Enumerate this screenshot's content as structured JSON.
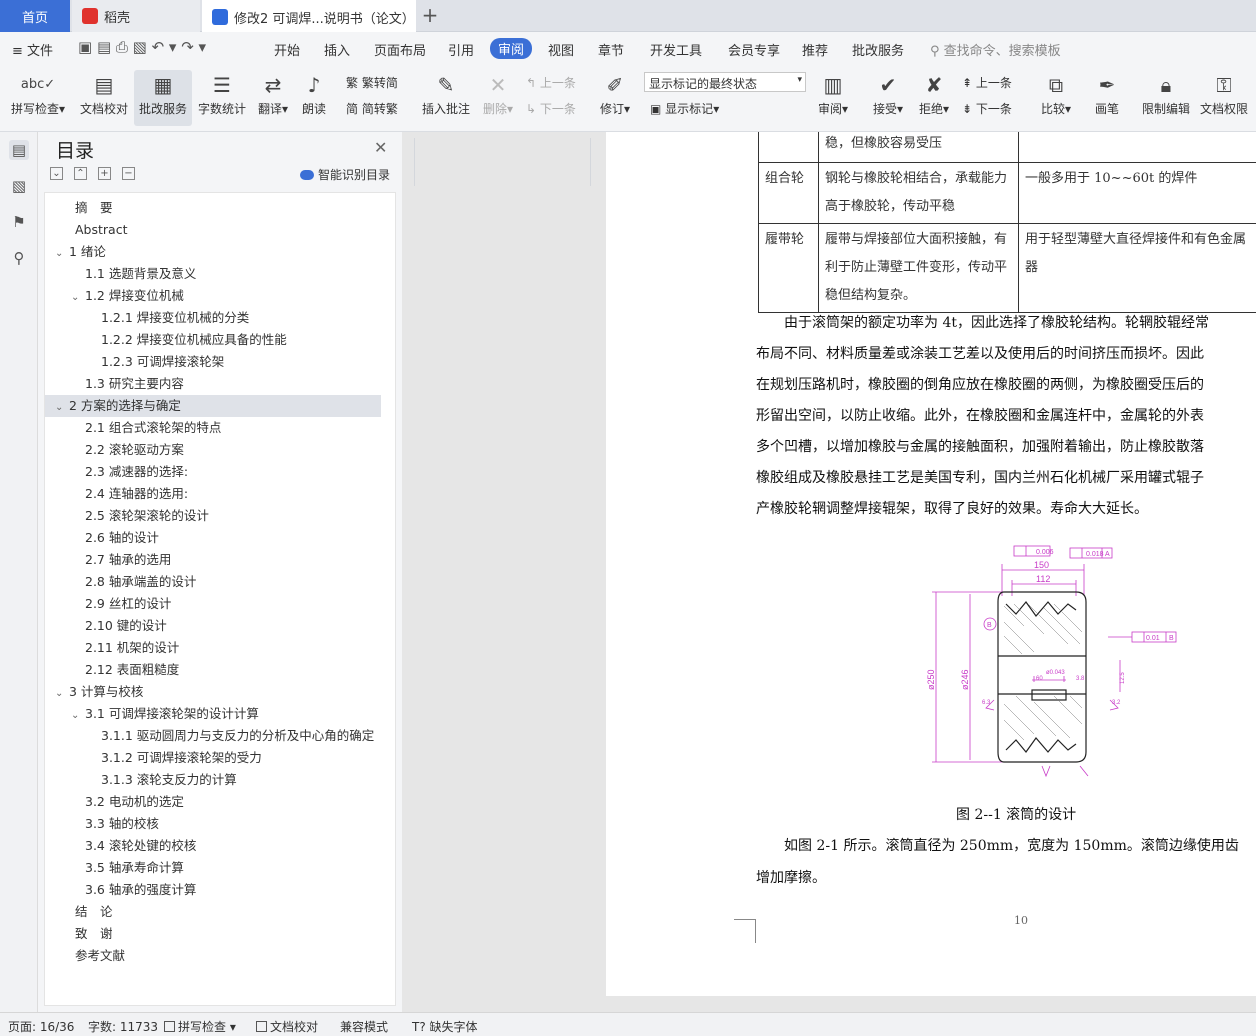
{
  "tabs": {
    "home": "首页",
    "daoke": "稻壳",
    "doc": "修改2 可调焊...说明书（论文）",
    "accent": "#3b6fd6"
  },
  "menubar": {
    "file": "文件",
    "items": [
      "开始",
      "插入",
      "页面布局",
      "引用",
      "审阅",
      "视图",
      "章节",
      "开发工具",
      "会员专享",
      "推荐",
      "批改服务"
    ],
    "active": "审阅",
    "search": "查找命令、搜索模板"
  },
  "ribbon": {
    "spellcheck": "拼写检查",
    "doccheck": "文档校对",
    "correction": "批改服务",
    "wordcount": "字数统计",
    "translate": "翻译",
    "read": "朗读",
    "trad": "繁转简",
    "simp": "简转繁",
    "insert_comment": "插入批注",
    "delete": "删除",
    "prev_comment": "上一条",
    "next_comment": "下一条",
    "track": "修订",
    "markup_state": "显示标记的最终状态",
    "show_markup": "显示标记",
    "review": "审阅",
    "accept": "接受",
    "reject": "拒绝",
    "prev": "上一条",
    "next": "下一条",
    "compare": "比较",
    "pen": "画笔",
    "restrict": "限制编辑",
    "perm": "文档权限"
  },
  "nav": {
    "title": "目录",
    "smart": "智能识别目录",
    "items": [
      {
        "text": "摘　要",
        "level": 0,
        "caret": ""
      },
      {
        "text": "Abstract",
        "level": 0,
        "caret": ""
      },
      {
        "text": "1  绪论",
        "level": 0,
        "caret": "v"
      },
      {
        "text": "1.1 选题背景及意义",
        "level": 1,
        "caret": ""
      },
      {
        "text": "1.2 焊接变位机械",
        "level": 1,
        "caret": "v"
      },
      {
        "text": "1.2.1 焊接变位机械的分类",
        "level": 2,
        "caret": ""
      },
      {
        "text": "1.2.2 焊接变位机械应具备的性能",
        "level": 2,
        "caret": ""
      },
      {
        "text": "1.2.3 可调焊接滚轮架",
        "level": 2,
        "caret": ""
      },
      {
        "text": "1.3  研究主要内容",
        "level": 1,
        "caret": ""
      },
      {
        "text": "2  方案的选择与确定",
        "level": 0,
        "caret": "v",
        "highlight": true
      },
      {
        "text": "2.1 组合式滚轮架的特点",
        "level": 1,
        "caret": ""
      },
      {
        "text": "2.2 滚轮驱动方案",
        "level": 1,
        "caret": ""
      },
      {
        "text": "2.3 减速器的选择:",
        "level": 1,
        "caret": ""
      },
      {
        "text": "2.4 连轴器的选用:",
        "level": 1,
        "caret": ""
      },
      {
        "text": "2.5 滚轮架滚轮的设计",
        "level": 1,
        "caret": ""
      },
      {
        "text": "2.6 轴的设计",
        "level": 1,
        "caret": ""
      },
      {
        "text": "2.7 轴承的选用",
        "level": 1,
        "caret": ""
      },
      {
        "text": "2.8 轴承端盖的设计",
        "level": 1,
        "caret": ""
      },
      {
        "text": "2.9 丝杠的设计",
        "level": 1,
        "caret": ""
      },
      {
        "text": "2.10 键的设计",
        "level": 1,
        "caret": ""
      },
      {
        "text": "2.11 机架的设计",
        "level": 1,
        "caret": ""
      },
      {
        "text": "2.12 表面粗糙度",
        "level": 1,
        "caret": ""
      },
      {
        "text": "3  计算与校核",
        "level": 0,
        "caret": "v"
      },
      {
        "text": "3.1 可调焊接滚轮架的设计计算",
        "level": 1,
        "caret": "v"
      },
      {
        "text": "3.1.1 驱动圆周力与支反力的分析及中心角的确定",
        "level": 2,
        "caret": ""
      },
      {
        "text": "3.1.2  可调焊接滚轮架的受力",
        "level": 2,
        "caret": ""
      },
      {
        "text": "3.1.3 滚轮支反力的计算",
        "level": 2,
        "caret": ""
      },
      {
        "text": "3.2 电动机的选定",
        "level": 1,
        "caret": ""
      },
      {
        "text": "3.3 轴的校核",
        "level": 1,
        "caret": ""
      },
      {
        "text": "3.4 滚轮处键的校核",
        "level": 1,
        "caret": ""
      },
      {
        "text": "3.5 轴承寿命计算",
        "level": 1,
        "caret": ""
      },
      {
        "text": "3.6 轴承的强度计算",
        "level": 1,
        "caret": ""
      },
      {
        "text": "结　论",
        "level": 0,
        "caret": ""
      },
      {
        "text": "致　谢",
        "level": 0,
        "caret": ""
      },
      {
        "text": "参考文献",
        "level": 0,
        "caret": ""
      }
    ]
  },
  "doc": {
    "table": [
      {
        "name": "",
        "desc": "稳，但橡胶容易受压",
        "use": ""
      },
      {
        "name": "组合轮",
        "desc": "钢轮与橡胶轮相结合，承载能力高于橡胶轮，传动平稳",
        "use": "一般多用于 10~~60t 的焊件"
      },
      {
        "name": "履带轮",
        "desc": "履带与焊接部位大面积接触，有利于防止薄壁工件变形，传动平稳但结构复杂。",
        "use": "用于轻型薄壁大直径焊接件和有色金属器"
      }
    ],
    "para_lines": [
      "　　由于滚筒架的额定功率为 4t，因此选择了橡胶轮结构。轮辋胶辊经常",
      "布局不同、材料质量差或涂装工艺差以及使用后的时间挤压而损坏。因此",
      "在规划压路机时，橡胶圈的倒角应放在橡胶圈的两侧，为橡胶圈受压后的",
      "形留出空间，以防止收缩。此外，在橡胶圈和金属连杆中，金属轮的外表",
      "多个凹槽，以增加橡胶与金属的接触面积，加强附着输出，防止橡胶散落",
      "橡胶组成及橡胶悬挂工艺是美国专利，国内兰州石化机械厂采用罐式辊子",
      "产橡胶轮辋调整焊接辊架，取得了良好的效果。寿命大大延长。"
    ],
    "figure": {
      "labels": {
        "d150": "150",
        "d112": "112",
        "dia250": "ø250",
        "dia246": "ø246",
        "flat": "0.006",
        "perp1": "0.018",
        "datumA": "A",
        "perp2": "0.01",
        "datumB": "B",
        "key": "ø0.043",
        "k60": "60",
        "k38": "3.8",
        "r6": "6.3",
        "r32": "3.2",
        "r125": "12.5",
        "bcirc": "B"
      },
      "caption": "图 2--1 滚筒的设计"
    },
    "para2_lines": [
      "　　如图 2-1 所示。滚筒直径为 250mm，宽度为 150mm。滚筒边缘使用齿",
      "增加摩擦。"
    ],
    "page_number": "10"
  },
  "status": {
    "page": "页面: 16/36",
    "words": "字数: 11733",
    "spell": "拼写检查",
    "proof": "文档校对",
    "compat": "兼容模式",
    "font": "缺失字体"
  }
}
